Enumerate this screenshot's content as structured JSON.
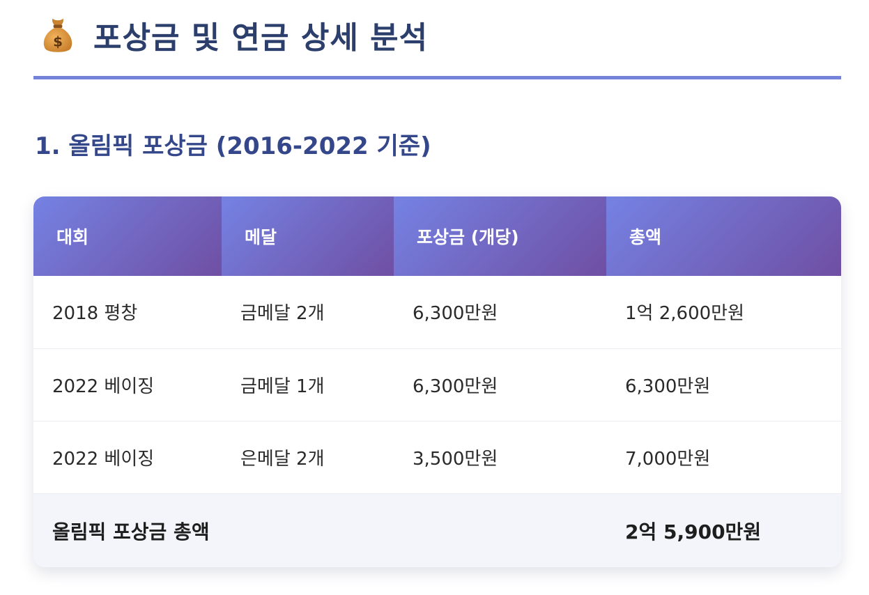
{
  "header": {
    "icon": "money-bag-icon",
    "title": "포상금 및 연금 상세 분석"
  },
  "colors": {
    "title": "#2c3e6b",
    "accent_rule": "#7582da",
    "section_title": "#34478a",
    "header_gradient_start": "#7582e3",
    "header_gradient_end": "#6f4fa3",
    "total_row_bg": "#f4f5fb"
  },
  "section": {
    "title": "1. 올림픽 포상금 (2016-2022 기준)"
  },
  "table": {
    "columns": [
      "대회",
      "메달",
      "포상금 (개당)",
      "총액"
    ],
    "rows": [
      [
        "2018 평창",
        "금메달 2개",
        "6,300만원",
        "1억 2,600만원"
      ],
      [
        "2022 베이징",
        "금메달 1개",
        "6,300만원",
        "6,300만원"
      ],
      [
        "2022 베이징",
        "은메달 2개",
        "3,500만원",
        "7,000만원"
      ]
    ],
    "total": {
      "label": "올림픽 포상금 총액",
      "value": "2억 5,900만원"
    }
  }
}
